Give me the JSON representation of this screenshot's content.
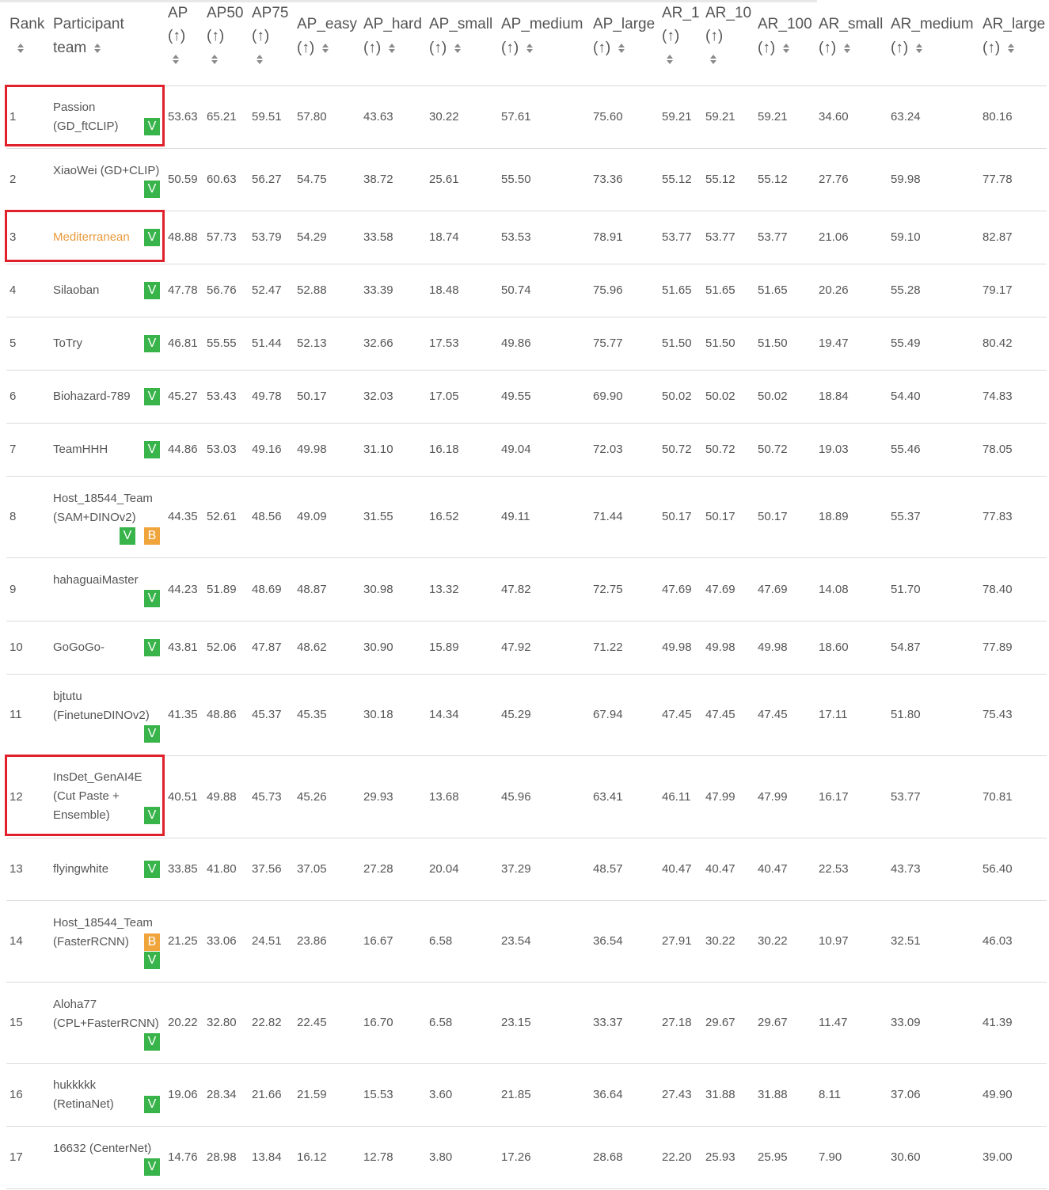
{
  "columns": [
    {
      "lines": [
        "Rank"
      ],
      "arrow": "",
      "sortable": true
    },
    {
      "lines": [
        "Participant",
        "team"
      ],
      "arrow": "",
      "sortable": true
    },
    {
      "lines": [
        "AP"
      ],
      "arrow": "(↑)",
      "sortable": true
    },
    {
      "lines": [
        "AP50"
      ],
      "arrow": "(↑)",
      "sortable": true
    },
    {
      "lines": [
        "AP75"
      ],
      "arrow": "(↑)",
      "sortable": true
    },
    {
      "lines": [
        "AP_easy"
      ],
      "arrow": "(↑)",
      "sortable": true
    },
    {
      "lines": [
        "AP_hard"
      ],
      "arrow": "(↑)",
      "sortable": true
    },
    {
      "lines": [
        "AP_small"
      ],
      "arrow": "(↑)",
      "sortable": true
    },
    {
      "lines": [
        "AP_medium"
      ],
      "arrow": "(↑)",
      "sortable": true
    },
    {
      "lines": [
        "AP_large"
      ],
      "arrow": "(↑)",
      "sortable": true
    },
    {
      "lines": [
        "AR_1"
      ],
      "arrow": "(↑)",
      "sortable": true
    },
    {
      "lines": [
        "AR_10"
      ],
      "arrow": "(↑)",
      "sortable": true
    },
    {
      "lines": [
        "AR_100"
      ],
      "arrow": "(↑)",
      "sortable": true
    },
    {
      "lines": [
        "AR_small"
      ],
      "arrow": "(↑)",
      "sortable": true
    },
    {
      "lines": [
        "AR_medium"
      ],
      "arrow": "(↑)",
      "sortable": true
    },
    {
      "lines": [
        "AR_large"
      ],
      "arrow": "(↑)",
      "sortable": true
    }
  ],
  "rows": [
    {
      "rank": "1",
      "team": [
        "Passion",
        "(GD_ftCLIP)"
      ],
      "badges": [
        "V"
      ],
      "badge_layout": "inline",
      "highlight_name": false,
      "boxed": true,
      "values": [
        "53.63",
        "65.21",
        "59.51",
        "57.80",
        "43.63",
        "30.22",
        "57.61",
        "75.60",
        "59.21",
        "59.21",
        "59.21",
        "34.60",
        "63.24",
        "80.16"
      ]
    },
    {
      "rank": "2",
      "team": [
        "XiaoWei (GD+CLIP)"
      ],
      "badges": [
        "V"
      ],
      "badge_layout": "below",
      "highlight_name": false,
      "boxed": false,
      "values": [
        "50.59",
        "60.63",
        "56.27",
        "54.75",
        "38.72",
        "25.61",
        "55.50",
        "73.36",
        "55.12",
        "55.12",
        "55.12",
        "27.76",
        "59.98",
        "77.78"
      ]
    },
    {
      "rank": "3",
      "team": [
        "Mediterranean"
      ],
      "badges": [
        "V"
      ],
      "badge_layout": "inline",
      "highlight_name": true,
      "boxed": true,
      "values": [
        "48.88",
        "57.73",
        "53.79",
        "54.29",
        "33.58",
        "18.74",
        "53.53",
        "78.91",
        "53.77",
        "53.77",
        "53.77",
        "21.06",
        "59.10",
        "82.87"
      ]
    },
    {
      "rank": "4",
      "team": [
        "Silaoban"
      ],
      "badges": [
        "V"
      ],
      "badge_layout": "inline",
      "highlight_name": false,
      "boxed": false,
      "values": [
        "47.78",
        "56.76",
        "52.47",
        "52.88",
        "33.39",
        "18.48",
        "50.74",
        "75.96",
        "51.65",
        "51.65",
        "51.65",
        "20.26",
        "55.28",
        "79.17"
      ]
    },
    {
      "rank": "5",
      "team": [
        "ToTry"
      ],
      "badges": [
        "V"
      ],
      "badge_layout": "inline",
      "highlight_name": false,
      "boxed": false,
      "values": [
        "46.81",
        "55.55",
        "51.44",
        "52.13",
        "32.66",
        "17.53",
        "49.86",
        "75.77",
        "51.50",
        "51.50",
        "51.50",
        "19.47",
        "55.49",
        "80.42"
      ]
    },
    {
      "rank": "6",
      "team": [
        "Biohazard-789"
      ],
      "badges": [
        "V"
      ],
      "badge_layout": "inline",
      "highlight_name": false,
      "boxed": false,
      "values": [
        "45.27",
        "53.43",
        "49.78",
        "50.17",
        "32.03",
        "17.05",
        "49.55",
        "69.90",
        "50.02",
        "50.02",
        "50.02",
        "18.84",
        "54.40",
        "74.83"
      ]
    },
    {
      "rank": "7",
      "team": [
        "TeamHHH"
      ],
      "badges": [
        "V"
      ],
      "badge_layout": "inline",
      "highlight_name": false,
      "boxed": false,
      "values": [
        "44.86",
        "53.03",
        "49.16",
        "49.98",
        "31.10",
        "16.18",
        "49.04",
        "72.03",
        "50.72",
        "50.72",
        "50.72",
        "19.03",
        "55.46",
        "78.05"
      ]
    },
    {
      "rank": "8",
      "team": [
        "Host_18544_Team",
        "(SAM+DINOv2)"
      ],
      "badges": [
        "V",
        "B"
      ],
      "badge_layout": "below",
      "highlight_name": false,
      "boxed": false,
      "values": [
        "44.35",
        "52.61",
        "48.56",
        "49.09",
        "31.55",
        "16.52",
        "49.11",
        "71.44",
        "50.17",
        "50.17",
        "50.17",
        "18.89",
        "55.37",
        "77.83"
      ]
    },
    {
      "rank": "9",
      "team": [
        "hahaguaiMaster"
      ],
      "badges": [
        "V"
      ],
      "badge_layout": "below",
      "highlight_name": false,
      "boxed": false,
      "values": [
        "44.23",
        "51.89",
        "48.69",
        "48.87",
        "30.98",
        "13.32",
        "47.82",
        "72.75",
        "47.69",
        "47.69",
        "47.69",
        "14.08",
        "51.70",
        "78.40"
      ]
    },
    {
      "rank": "10",
      "team": [
        "GoGoGo-"
      ],
      "badges": [
        "V"
      ],
      "badge_layout": "inline",
      "highlight_name": false,
      "boxed": false,
      "values": [
        "43.81",
        "52.06",
        "47.87",
        "48.62",
        "30.90",
        "15.89",
        "47.92",
        "71.22",
        "49.98",
        "49.98",
        "49.98",
        "18.60",
        "54.87",
        "77.89"
      ]
    },
    {
      "rank": "11",
      "team": [
        "bjtutu",
        "(FinetuneDINOv2)"
      ],
      "badges": [
        "V"
      ],
      "badge_layout": "below",
      "highlight_name": false,
      "boxed": false,
      "values": [
        "41.35",
        "48.86",
        "45.37",
        "45.35",
        "30.18",
        "14.34",
        "45.29",
        "67.94",
        "47.45",
        "47.45",
        "47.45",
        "17.11",
        "51.80",
        "75.43"
      ]
    },
    {
      "rank": "12",
      "team": [
        "InsDet_GenAI4E",
        "(Cut Paste +",
        "Ensemble)"
      ],
      "badges": [
        "V"
      ],
      "badge_layout": "inline",
      "highlight_name": false,
      "boxed": true,
      "values": [
        "40.51",
        "49.88",
        "45.73",
        "45.26",
        "29.93",
        "13.68",
        "45.96",
        "63.41",
        "46.11",
        "47.99",
        "47.99",
        "16.17",
        "53.77",
        "70.81"
      ]
    },
    {
      "rank": "13",
      "team": [
        "flyingwhite"
      ],
      "badges": [
        "V"
      ],
      "badge_layout": "inline",
      "highlight_name": false,
      "boxed": false,
      "values": [
        "33.85",
        "41.80",
        "37.56",
        "37.05",
        "27.28",
        "20.04",
        "37.29",
        "48.57",
        "40.47",
        "40.47",
        "40.47",
        "22.53",
        "43.73",
        "56.40"
      ]
    },
    {
      "rank": "14",
      "team": [
        "Host_18544_Team",
        "(FasterRCNN)"
      ],
      "badges": [
        "B",
        "V"
      ],
      "badge_layout": "stacked",
      "highlight_name": false,
      "boxed": false,
      "values": [
        "21.25",
        "33.06",
        "24.51",
        "23.86",
        "16.67",
        "6.58",
        "23.54",
        "36.54",
        "27.91",
        "30.22",
        "30.22",
        "10.97",
        "32.51",
        "46.03"
      ]
    },
    {
      "rank": "15",
      "team": [
        "Aloha77",
        "(CPL+FasterRCNN)"
      ],
      "badges": [
        "V"
      ],
      "badge_layout": "below",
      "highlight_name": false,
      "boxed": false,
      "values": [
        "20.22",
        "32.80",
        "22.82",
        "22.45",
        "16.70",
        "6.58",
        "23.15",
        "33.37",
        "27.18",
        "29.67",
        "29.67",
        "11.47",
        "33.09",
        "41.39"
      ]
    },
    {
      "rank": "16",
      "team": [
        "hukkkkk",
        "(RetinaNet)"
      ],
      "badges": [
        "V"
      ],
      "badge_layout": "inline",
      "highlight_name": false,
      "boxed": false,
      "values": [
        "19.06",
        "28.34",
        "21.66",
        "21.59",
        "15.53",
        "3.60",
        "21.85",
        "36.64",
        "27.43",
        "31.88",
        "31.88",
        "8.11",
        "37.06",
        "49.90"
      ]
    },
    {
      "rank": "17",
      "team": [
        "16632 (CenterNet)"
      ],
      "badges": [
        "V"
      ],
      "badge_layout": "below",
      "highlight_name": false,
      "boxed": false,
      "values": [
        "14.76",
        "28.98",
        "13.84",
        "16.12",
        "12.78",
        "3.80",
        "17.26",
        "28.68",
        "22.20",
        "25.93",
        "25.95",
        "7.90",
        "30.60",
        "39.00"
      ]
    }
  ],
  "colors": {
    "verified_badge": "#38b44a",
    "baseline_badge": "#f0a53c",
    "highlight_name": "#e89a3c",
    "annotation_box": "#e0202a"
  },
  "icons": {
    "sort": "sort-icon",
    "verified": "verified-badge",
    "baseline": "baseline-badge"
  }
}
